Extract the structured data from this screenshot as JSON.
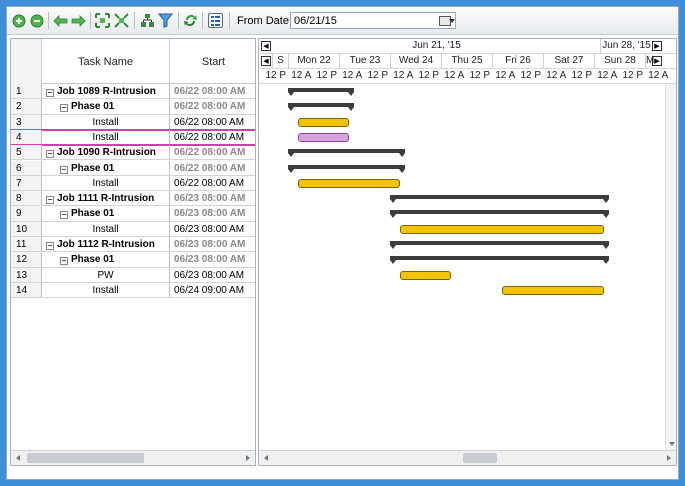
{
  "toolbar": {
    "icons": [
      "zoom-in-icon",
      "zoom-out-icon",
      "arrow-left-icon",
      "arrow-right-icon",
      "fit-width-icon",
      "fit-all-icon",
      "hierarchy-icon",
      "filter-icon",
      "refresh-icon",
      "properties-icon"
    ],
    "from_date_label": "From Date:",
    "from_date_value": "06/21/15"
  },
  "grid": {
    "columns": {
      "num": "",
      "name": "Task Name",
      "start": "Start"
    },
    "rows": [
      {
        "num": "1",
        "name": "Job 1089 R-Intrusion",
        "start": "06/22 08:00 AM",
        "level": 0,
        "summary": true
      },
      {
        "num": "2",
        "name": "Phase 01",
        "start": "06/22 08:00 AM",
        "level": 1,
        "summary": true
      },
      {
        "num": "3",
        "name": "Install",
        "start": "06/22 08:00 AM",
        "level": 2,
        "summary": false
      },
      {
        "num": "4",
        "name": "Install",
        "start": "06/22 08:00 AM",
        "level": 2,
        "summary": false,
        "selected": true
      },
      {
        "num": "5",
        "name": "Job 1090 R-Intrusion",
        "start": "06/22 08:00 AM",
        "level": 0,
        "summary": true
      },
      {
        "num": "6",
        "name": "Phase 01",
        "start": "06/22 08:00 AM",
        "level": 1,
        "summary": true
      },
      {
        "num": "7",
        "name": "Install",
        "start": "06/22 08:00 AM",
        "level": 2,
        "summary": false
      },
      {
        "num": "8",
        "name": "Job 1111 R-Intrusion",
        "start": "06/23 08:00 AM",
        "level": 0,
        "summary": true
      },
      {
        "num": "9",
        "name": "Phase 01",
        "start": "06/23 08:00 AM",
        "level": 1,
        "summary": true
      },
      {
        "num": "10",
        "name": "Install",
        "start": "06/23 08:00 AM",
        "level": 2,
        "summary": false
      },
      {
        "num": "11",
        "name": "Job 1112 R-Intrusion",
        "start": "06/23 08:00 AM",
        "level": 0,
        "summary": true
      },
      {
        "num": "12",
        "name": "Phase 01",
        "start": "06/23 08:00 AM",
        "level": 1,
        "summary": true
      },
      {
        "num": "13",
        "name": "PW",
        "start": "06/23 08:00 AM",
        "level": 2,
        "summary": false
      },
      {
        "num": "14",
        "name": "Install",
        "start": "06/24 09:00 AM",
        "level": 2,
        "summary": false
      }
    ]
  },
  "timeline": {
    "weeks": [
      "Jun 21, '15",
      "Jun 28, '15"
    ],
    "days": [
      "S",
      "Mon 22",
      "Tue 23",
      "Wed 24",
      "Thu 25",
      "Fri 26",
      "Sat 27",
      "Sun 28",
      "M"
    ],
    "hours": [
      "12 P",
      "12 A",
      "12 P",
      "12 A",
      "12 P",
      "12 A",
      "12 P",
      "12 A",
      "12 P",
      "12 A",
      "12 P",
      "12 A",
      "12 P",
      "12 A",
      "12 P",
      "12 A"
    ]
  },
  "bars": [
    {
      "row": 1,
      "type": "summary",
      "start": 1.0,
      "end": 2.3
    },
    {
      "row": 2,
      "type": "summary",
      "start": 1.0,
      "end": 2.3
    },
    {
      "row": 3,
      "type": "task",
      "start": 1.2,
      "end": 2.2,
      "color": "#f2c400"
    },
    {
      "row": 4,
      "type": "task",
      "start": 1.2,
      "end": 2.2,
      "color": "#d7a3de"
    },
    {
      "row": 5,
      "type": "summary",
      "start": 1.0,
      "end": 3.3
    },
    {
      "row": 6,
      "type": "summary",
      "start": 1.0,
      "end": 3.3
    },
    {
      "row": 7,
      "type": "task",
      "start": 1.2,
      "end": 3.2,
      "color": "#f2c400"
    },
    {
      "row": 8,
      "type": "summary",
      "start": 3.0,
      "end": 7.3
    },
    {
      "row": 9,
      "type": "summary",
      "start": 3.0,
      "end": 7.3
    },
    {
      "row": 10,
      "type": "task",
      "start": 3.2,
      "end": 7.2,
      "color": "#f2c400"
    },
    {
      "row": 11,
      "type": "summary",
      "start": 3.0,
      "end": 7.3
    },
    {
      "row": 12,
      "type": "summary",
      "start": 3.0,
      "end": 7.3
    },
    {
      "row": 13,
      "type": "task",
      "start": 3.2,
      "end": 4.2,
      "color": "#f2c400"
    },
    {
      "row": 14,
      "type": "task",
      "start": 5.2,
      "end": 7.2,
      "color": "#f2c400"
    }
  ]
}
